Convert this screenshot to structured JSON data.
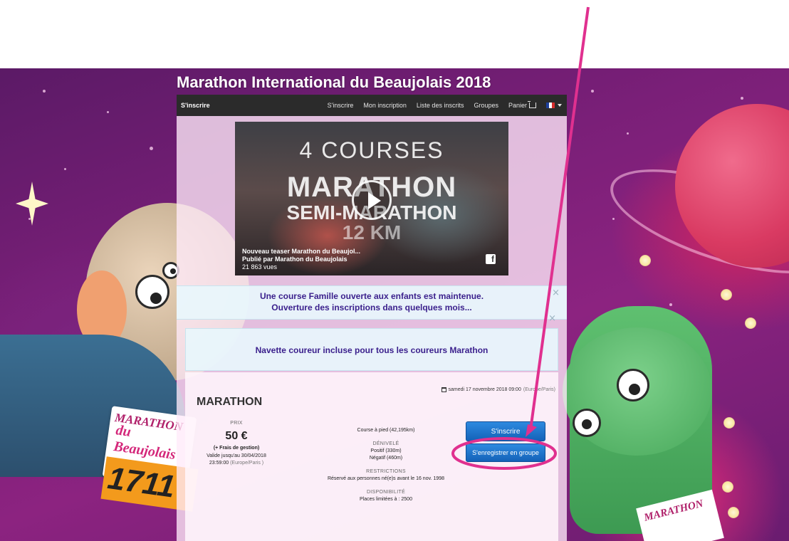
{
  "page": {
    "title": "Marathon International du Beaujolais 2018"
  },
  "navbar": {
    "brand": "S'inscrire",
    "items": [
      {
        "label": "S'inscrire"
      },
      {
        "label": "Mon inscription"
      },
      {
        "label": "Liste des inscrits"
      },
      {
        "label": "Groupes"
      },
      {
        "label": "Panier"
      }
    ],
    "language_flag_colors": [
      "#1d3f9b",
      "#ffffff",
      "#d52b2b"
    ]
  },
  "video": {
    "lines": [
      "4 COURSES",
      "MARATHON",
      "SEMI-MARATHON",
      "12 KM"
    ],
    "caption_title": "Nouveau teaser Marathon du Beaujol...",
    "caption_author": "Publié par Marathon du Beaujolais",
    "caption_views": "21 863 vues",
    "facebook_glyph": "f"
  },
  "alerts": {
    "family_race_line1": "Une course Famille ouverte aux enfants est maintenue.",
    "family_race_line2": "Ouverture des inscriptions dans quelques mois...",
    "shuttle": "Navette coureur incluse pour tous les coureurs Marathon",
    "close_glyph": "×"
  },
  "race": {
    "date": "samedi 17 novembre 2018 09:00",
    "date_tz": "(Europe/Paris)",
    "name": "MARATHON",
    "price_label": "PRIX",
    "price": "50 €",
    "fees": "(+ Frais de gestion)",
    "valid_until": "Valide jusqu'au 30/04/2018",
    "valid_time": "23:59:00",
    "valid_tz": "(Europe/Paris )",
    "type": "Course à pied (42,195km)",
    "elevation_label": "DÉNIVELÉ",
    "elevation_positive": "Positif (330m)",
    "elevation_negative": "Négatif (460m)",
    "restrictions_label": "RESTRICTIONS",
    "restrictions": "Réservé aux personnes né(e)s avant le 16 nov. 1998",
    "availability_label": "DISPONIBILITÉ",
    "availability": "Places limitées à : 2500",
    "register_button": "S'inscrire",
    "group_button": "S'enregistrer en groupe"
  },
  "background": {
    "bib_left_line1": "MARATHON",
    "bib_left_line2": "du Beaujolais",
    "bib_left_number": "1711",
    "bib_right_text": "MARATHON"
  },
  "colors": {
    "annotation": "#e0308f",
    "button": "#1d6fcc",
    "alert_text": "#3a1f8c"
  }
}
